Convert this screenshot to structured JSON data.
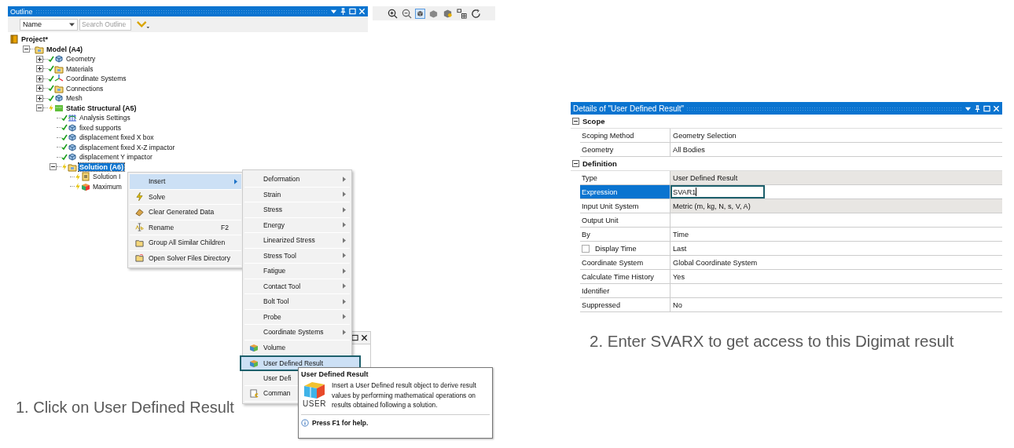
{
  "outline": {
    "title": "Outline",
    "filter": {
      "column": "Name",
      "placeholder": "Search Outline"
    },
    "tree": [
      {
        "label": "Project*",
        "bold": true,
        "selected": false,
        "children": [
          {
            "label": "Model (A4)",
            "bold": true,
            "selected": false,
            "expanded": true,
            "children": [
              {
                "label": "Geometry",
                "bold": false,
                "selected": false,
                "expanded": false,
                "solved": true
              },
              {
                "label": "Materials",
                "bold": false,
                "selected": false,
                "expanded": false,
                "solved": true
              },
              {
                "label": "Coordinate Systems",
                "bold": false,
                "selected": false,
                "expanded": false,
                "solved": true
              },
              {
                "label": "Connections",
                "bold": false,
                "selected": false,
                "expanded": false,
                "solved": true
              },
              {
                "label": "Mesh",
                "bold": false,
                "selected": false,
                "expanded": false,
                "solved": true
              },
              {
                "label": "Static Structural (A5)",
                "bold": true,
                "selected": false,
                "expanded": true,
                "solved": false,
                "children": [
                  {
                    "label": "Analysis Settings",
                    "bold": false,
                    "selected": false,
                    "solved": true
                  },
                  {
                    "label": "fixed supports",
                    "bold": false,
                    "selected": false,
                    "solved": true
                  },
                  {
                    "label": "displacement fixed X box",
                    "bold": false,
                    "selected": false,
                    "solved": true
                  },
                  {
                    "label": "displacement fixed X-Z impactor",
                    "bold": false,
                    "selected": false,
                    "solved": true
                  },
                  {
                    "label": "displacement Y impactor",
                    "bold": false,
                    "selected": false,
                    "solved": true
                  },
                  {
                    "label": "Solution (A6)",
                    "bold": true,
                    "selected": true,
                    "expanded": true,
                    "solved": false,
                    "children": [
                      {
                        "label": "Solution I",
                        "bold": false,
                        "selected": false,
                        "solved": false
                      },
                      {
                        "label": "Maximum",
                        "bold": false,
                        "selected": false,
                        "solved": false
                      }
                    ]
                  }
                ]
              }
            ]
          }
        ]
      }
    ]
  },
  "context_menu": [
    {
      "label": "Insert",
      "submenu": true,
      "selected": true
    },
    {
      "label": "Solve",
      "submenu": false,
      "selected": false
    },
    {
      "label": "Clear Generated Data",
      "submenu": false,
      "selected": false
    },
    {
      "label": "Rename",
      "shortcut": "F2",
      "submenu": false,
      "selected": false
    },
    {
      "label": "Group All Similar Children",
      "submenu": false,
      "selected": false
    },
    {
      "label": "Open Solver Files Directory",
      "submenu": false,
      "selected": false
    }
  ],
  "insert_menu": [
    {
      "label": "Deformation",
      "submenu": true,
      "selected": false,
      "callout": false
    },
    {
      "label": "Strain",
      "submenu": true,
      "selected": false,
      "callout": false
    },
    {
      "label": "Stress",
      "submenu": true,
      "selected": false,
      "callout": false
    },
    {
      "label": "Energy",
      "submenu": true,
      "selected": false,
      "callout": false
    },
    {
      "label": "Linearized Stress",
      "submenu": true,
      "selected": false,
      "callout": false
    },
    {
      "label": "Stress Tool",
      "submenu": true,
      "selected": false,
      "callout": false
    },
    {
      "label": "Fatigue",
      "submenu": true,
      "selected": false,
      "callout": false
    },
    {
      "label": "Contact Tool",
      "submenu": true,
      "selected": false,
      "callout": false
    },
    {
      "label": "Bolt Tool",
      "submenu": true,
      "selected": false,
      "callout": false
    },
    {
      "label": "Probe",
      "submenu": true,
      "selected": false,
      "callout": false
    },
    {
      "label": "Coordinate Systems",
      "submenu": true,
      "selected": false,
      "callout": false
    },
    {
      "label": "Volume",
      "submenu": false,
      "selected": false,
      "callout": false
    },
    {
      "label": "User Defined Result",
      "submenu": false,
      "selected": true,
      "callout": true
    },
    {
      "label": "User Defi",
      "selected": false,
      "callout": false
    },
    {
      "label": "Comman",
      "selected": false,
      "callout": false
    }
  ],
  "tooltip": {
    "title": "User Defined Result",
    "icon_label": "USER",
    "body": "Insert a User Defined result object to derive result values by performing mathematical operations on results obtained following a solution.",
    "help": "Press F1 for help."
  },
  "details": {
    "title": "Details of \"User Defined Result\"",
    "groups": [
      {
        "name": "Scope",
        "expanded": true,
        "rows": [
          {
            "label": "Scoping Method",
            "value": "Geometry Selection",
            "selected": false,
            "readonly": false
          },
          {
            "label": "Geometry",
            "value": "All Bodies",
            "selected": false,
            "readonly": false
          }
        ]
      },
      {
        "name": "Definition",
        "expanded": true,
        "rows": [
          {
            "label": "Type",
            "value": "User Defined Result",
            "selected": false,
            "readonly": true
          },
          {
            "label": "Expression",
            "value": "SVAR1",
            "selected": true,
            "readonly": false,
            "editing": true
          },
          {
            "label": "Input Unit System",
            "value": "Metric (m, kg, N, s, V, A)",
            "selected": false,
            "readonly": true
          },
          {
            "label": "Output Unit",
            "selected": false,
            "readonly": false
          },
          {
            "label": "By",
            "value": "Time",
            "selected": false,
            "readonly": false
          },
          {
            "label": "Display Time",
            "value": "Last",
            "selected": false,
            "readonly": false,
            "checked": false
          },
          {
            "label": "Coordinate System",
            "value": "Global Coordinate System",
            "selected": false,
            "readonly": false
          },
          {
            "label": "Calculate Time History",
            "value": "Yes",
            "selected": false,
            "readonly": false
          },
          {
            "label": "Identifier",
            "selected": false,
            "readonly": false
          },
          {
            "label": "Suppressed",
            "value": "No",
            "selected": false,
            "readonly": false
          }
        ]
      }
    ]
  },
  "captions": [
    "1.  Click on User Defined Result",
    "2. Enter SVARX to get access to this Digimat result"
  ]
}
